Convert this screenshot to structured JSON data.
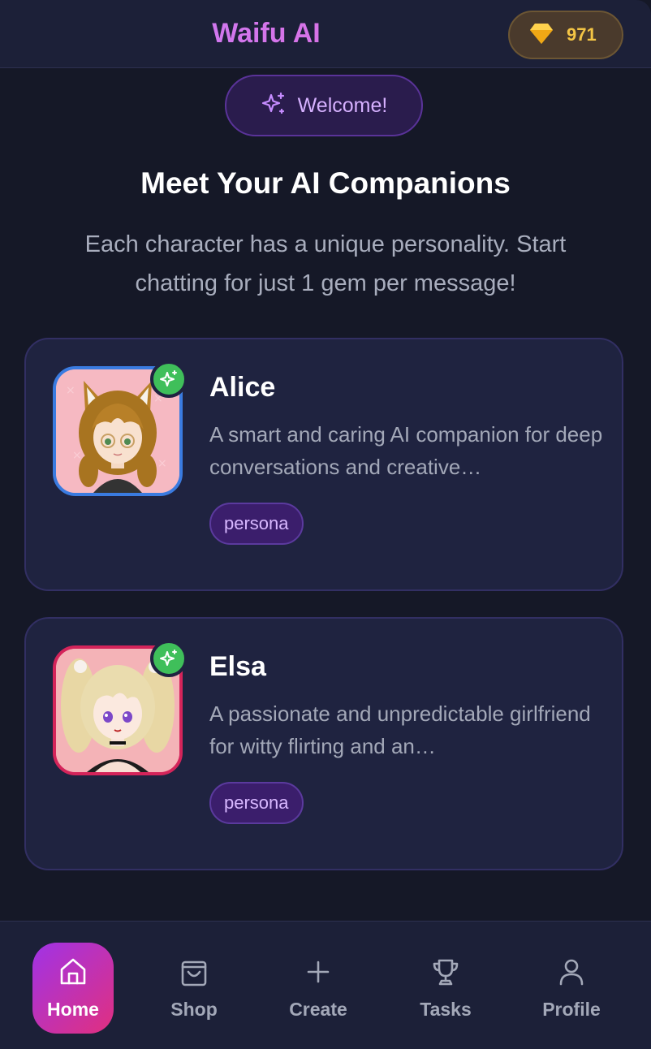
{
  "header": {
    "brand": "Waifu AI",
    "gem_count": "971"
  },
  "welcome": {
    "label": "Welcome!"
  },
  "main": {
    "title": "Meet Your AI Companions",
    "subtitle": "Each character has a unique personality. Start chatting for just 1 gem per message!"
  },
  "characters": [
    {
      "name": "Alice",
      "description": "A smart and caring AI companion for deep conversations and creative…",
      "tag": "persona",
      "avatar_icon": "fox-ear-girl-avatar",
      "accent": "#3a7be0"
    },
    {
      "name": "Elsa",
      "description": "A passionate and unpredictable girlfriend for witty flirting and an…",
      "tag": "persona",
      "avatar_icon": "blonde-girl-avatar",
      "accent": "#d4245a"
    }
  ],
  "nav": {
    "items": [
      {
        "label": "Home",
        "icon": "home-icon",
        "active": true
      },
      {
        "label": "Shop",
        "icon": "shopping-bag-icon",
        "active": false
      },
      {
        "label": "Create",
        "icon": "plus-icon",
        "active": false
      },
      {
        "label": "Tasks",
        "icon": "trophy-icon",
        "active": false
      },
      {
        "label": "Profile",
        "icon": "user-icon",
        "active": false
      }
    ]
  },
  "colors": {
    "background": "#151827",
    "card": "#1f2340",
    "brand_gradient_start": "#c580ff",
    "gem": "#f4c545",
    "online_badge": "#3fbf5a",
    "active_nav_gradient_start": "#a033e6",
    "active_nav_gradient_end": "#e1307f"
  }
}
